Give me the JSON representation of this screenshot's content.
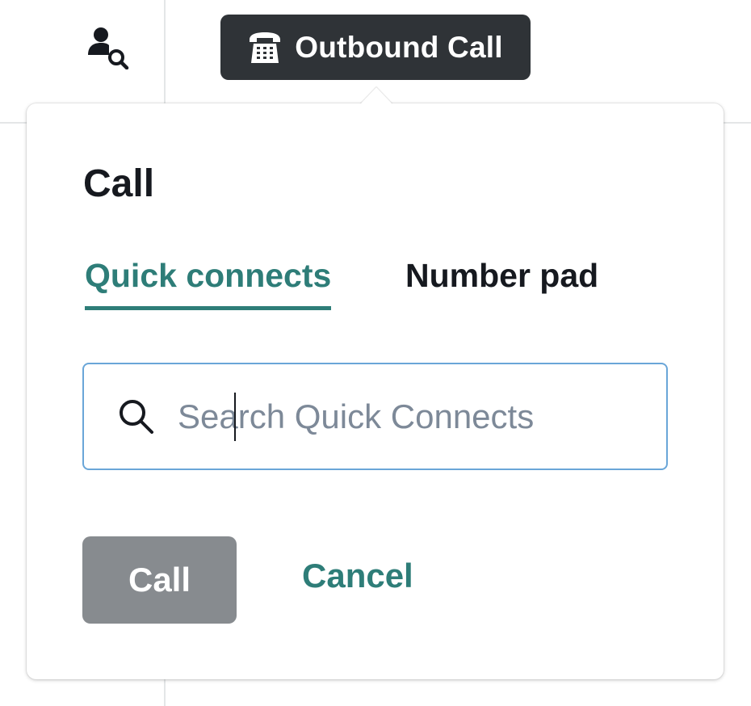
{
  "toolbar": {
    "user_search_icon": "user-search-icon",
    "outbound_call": {
      "icon": "telephone-keypad-icon",
      "label": "Outbound Call"
    }
  },
  "popover": {
    "title": "Call",
    "tabs": [
      {
        "label": "Quick connects",
        "selected": true
      },
      {
        "label": "Number pad",
        "selected": false
      }
    ],
    "search": {
      "icon": "search-icon",
      "placeholder": "Search Quick Connects",
      "value": ""
    },
    "actions": {
      "call_label": "Call",
      "cancel_label": "Cancel"
    }
  },
  "colors": {
    "accent": "#2e7d78",
    "pill_bg": "#2f3337",
    "call_button_disabled": "#878b8f",
    "focus_border": "#6aa6d8"
  }
}
